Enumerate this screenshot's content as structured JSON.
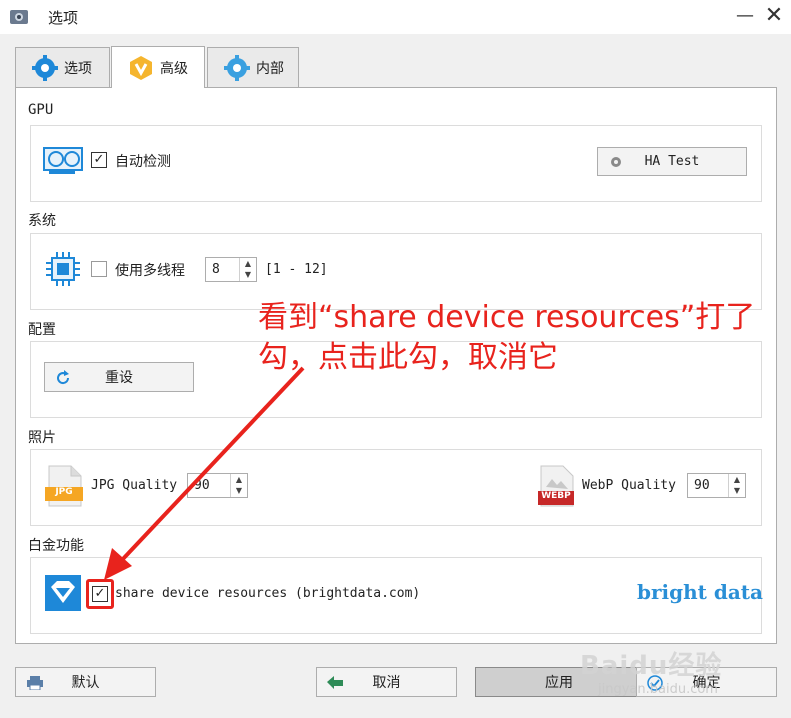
{
  "window": {
    "title": "选项"
  },
  "tabs": [
    {
      "label": "选项",
      "icon": "gear-icon"
    },
    {
      "label": "高级",
      "icon": "v-badge-icon"
    },
    {
      "label": "内部",
      "icon": "gear-icon"
    }
  ],
  "gpu": {
    "label": "GPU",
    "checkbox_label": "自动检测",
    "checked": true,
    "ha_test_label": "HA Test"
  },
  "system": {
    "label": "系统",
    "checkbox_label": "使用多线程",
    "checked": false,
    "threads_value": "8",
    "range_text": "[1 - 12]"
  },
  "config": {
    "label": "配置",
    "reset_label": "重设"
  },
  "photo": {
    "label": "照片",
    "jpg_label": "JPG Quality",
    "jpg_value": "90",
    "jpg_icon_text": "JPG",
    "webp_label": "WebP Quality",
    "webp_value": "90",
    "webp_icon_text": "WEBP"
  },
  "platinum": {
    "label": "白金功能",
    "checkbox_label": "share device resources (brightdata.com)",
    "checked": true,
    "brand": "bright data"
  },
  "annotation": "看到“share device resources”打了勾，点击此勾，取消它",
  "footer": {
    "default_label": "默认",
    "cancel_label": "取消",
    "apply_label": "应用",
    "ok_label": "确定"
  },
  "watermark": {
    "main": "Baidu经验",
    "sub": "jingyan.baidu.com"
  },
  "colors": {
    "accent_blue": "#1e88d8",
    "annotation_red": "#e8231d",
    "brand_blue": "#2a8fd6",
    "v_badge": "#f5b52e"
  }
}
